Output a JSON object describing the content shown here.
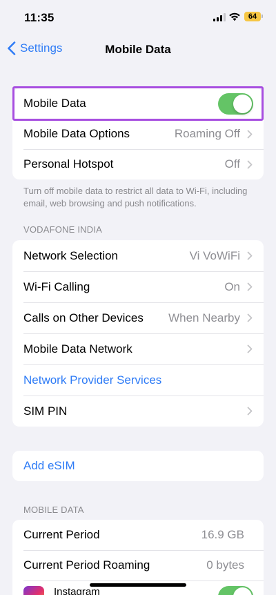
{
  "status_bar": {
    "time": "11:35",
    "battery_level": "64",
    "battery_color": "#f6c644"
  },
  "nav": {
    "back_label": "Settings",
    "title": "Mobile Data"
  },
  "colors": {
    "accent": "#2f7cf6",
    "toggle_on": "#64c466",
    "highlight": "#a74ee0",
    "background": "#f2f2f7"
  },
  "group1": {
    "mobile_data": {
      "label": "Mobile Data",
      "toggle": "on"
    },
    "options": {
      "label": "Mobile Data Options",
      "value": "Roaming Off"
    },
    "hotspot": {
      "label": "Personal Hotspot",
      "value": "Off"
    },
    "footer": "Turn off mobile data to restrict all data to Wi-Fi, including email, web browsing and push notifications."
  },
  "carrier_section": {
    "header": "VODAFONE INDIA",
    "rows": [
      {
        "label": "Network Selection",
        "value": "Vi VoWiFi"
      },
      {
        "label": "Wi-Fi Calling",
        "value": "On"
      },
      {
        "label": "Calls on Other Devices",
        "value": "When Nearby"
      },
      {
        "label": "Mobile Data Network",
        "value": ""
      },
      {
        "label": "Network Provider Services",
        "value": ""
      },
      {
        "label": "SIM PIN",
        "value": ""
      }
    ]
  },
  "esim": {
    "label": "Add eSIM"
  },
  "usage_section": {
    "header": "MOBILE DATA",
    "rows": [
      {
        "label": "Current Period",
        "value": "16.9 GB"
      },
      {
        "label": "Current Period Roaming",
        "value": "0 bytes"
      },
      {
        "label": "Instagram",
        "toggle": "on"
      }
    ]
  }
}
